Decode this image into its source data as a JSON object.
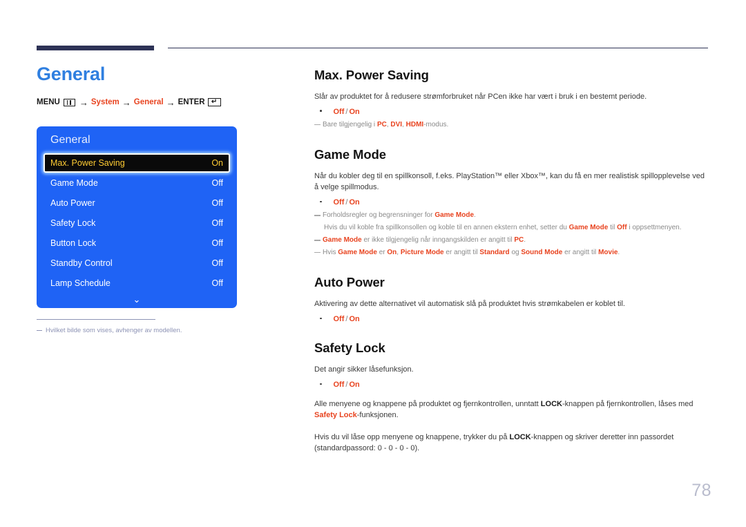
{
  "page": {
    "number": "78",
    "title": "General"
  },
  "menu_path": {
    "menu_label": "MENU",
    "menu_icon": "menu-bars-icon",
    "arrow": "→",
    "step1": "System",
    "step2": "General",
    "enter_label": "ENTER",
    "enter_icon": "↵"
  },
  "osd": {
    "title": "General",
    "rows": [
      {
        "label": "Max. Power Saving",
        "value": "On",
        "selected": true
      },
      {
        "label": "Game Mode",
        "value": "Off",
        "selected": false
      },
      {
        "label": "Auto Power",
        "value": "Off",
        "selected": false
      },
      {
        "label": "Safety Lock",
        "value": "Off",
        "selected": false
      },
      {
        "label": "Button Lock",
        "value": "Off",
        "selected": false
      },
      {
        "label": "Standby Control",
        "value": "Off",
        "selected": false
      },
      {
        "label": "Lamp Schedule",
        "value": "Off",
        "selected": false
      }
    ],
    "scroll_chevron": "⌄",
    "panel_bg": "#1f63f5",
    "selected_text_color": "#ffcc33"
  },
  "left_note": {
    "text": "Hvilket bilde som vises, avhenger av modellen."
  },
  "sections": {
    "max_power_saving": {
      "heading": "Max. Power Saving",
      "body": "Slår av produktet for å redusere strømforbruket når PCen ikke har vært i bruk i en bestemt periode.",
      "option_off": "Off",
      "option_sep": "/",
      "option_on": "On",
      "note_pre": "Bare tilgjengelig i ",
      "note_pc": "PC",
      "note_c1": ", ",
      "note_dvi": "DVI",
      "note_c2": ", ",
      "note_hdmi": "HDMI",
      "note_post": "-modus."
    },
    "game_mode": {
      "heading": "Game Mode",
      "body": "Når du kobler deg til en spillkonsoll, f.eks. PlayStation™ eller Xbox™, kan du få en mer realistisk spillopplevelse ved å velge spillmodus.",
      "option_off": "Off",
      "option_sep": "/",
      "option_on": "On",
      "note1_pre": "Forholdsregler og begrensninger for ",
      "note1_bold": "Game Mode",
      "note1_post": ".",
      "note1_sub_pre": "Hvis du  vil koble fra spillkonsollen og koble til en annen ekstern enhet, setter du ",
      "note1_sub_b1": "Game Mode",
      "note1_sub_mid": " til ",
      "note1_sub_b2": "Off",
      "note1_sub_post": " i oppsettmenyen.",
      "note2_b1": "Game Mode",
      "note2_mid": " er ikke tilgjengelig når inngangskilden er angitt til ",
      "note2_b2": "PC",
      "note2_post": ".",
      "note3_pre": "Hvis ",
      "note3_b1": "Game Mode",
      "note3_m1": " er ",
      "note3_b2": "On",
      "note3_m2": ", ",
      "note3_b3": "Picture Mode",
      "note3_m3": " er angitt til ",
      "note3_b4": "Standard",
      "note3_m4": " og ",
      "note3_b5": "Sound Mode",
      "note3_m5": " er angitt til ",
      "note3_b6": "Movie",
      "note3_post": "."
    },
    "auto_power": {
      "heading": "Auto Power",
      "body": "Aktivering av dette alternativet vil automatisk slå på produktet hvis strømkabelen er koblet til.",
      "option_off": "Off",
      "option_sep": "/",
      "option_on": "On"
    },
    "safety_lock": {
      "heading": "Safety Lock",
      "body": "Det angir sikker låsefunksjon.",
      "option_off": "Off",
      "option_sep": "/",
      "option_on": "On",
      "para1_pre": "Alle menyene og knappene på produktet og fjernkontrollen, unntatt ",
      "para1_b1": "LOCK",
      "para1_mid": "-knappen på fjernkontrollen, låses med ",
      "para1_b2": "Safety Lock",
      "para1_post": "-funksjonen.",
      "para2_pre": "Hvis du vil låse opp menyene og knappene, trykker du på ",
      "para2_b1": "LOCK",
      "para2_post": "-knappen og skriver deretter inn passordet (standardpassord: 0 - 0 - 0 - 0)."
    }
  }
}
